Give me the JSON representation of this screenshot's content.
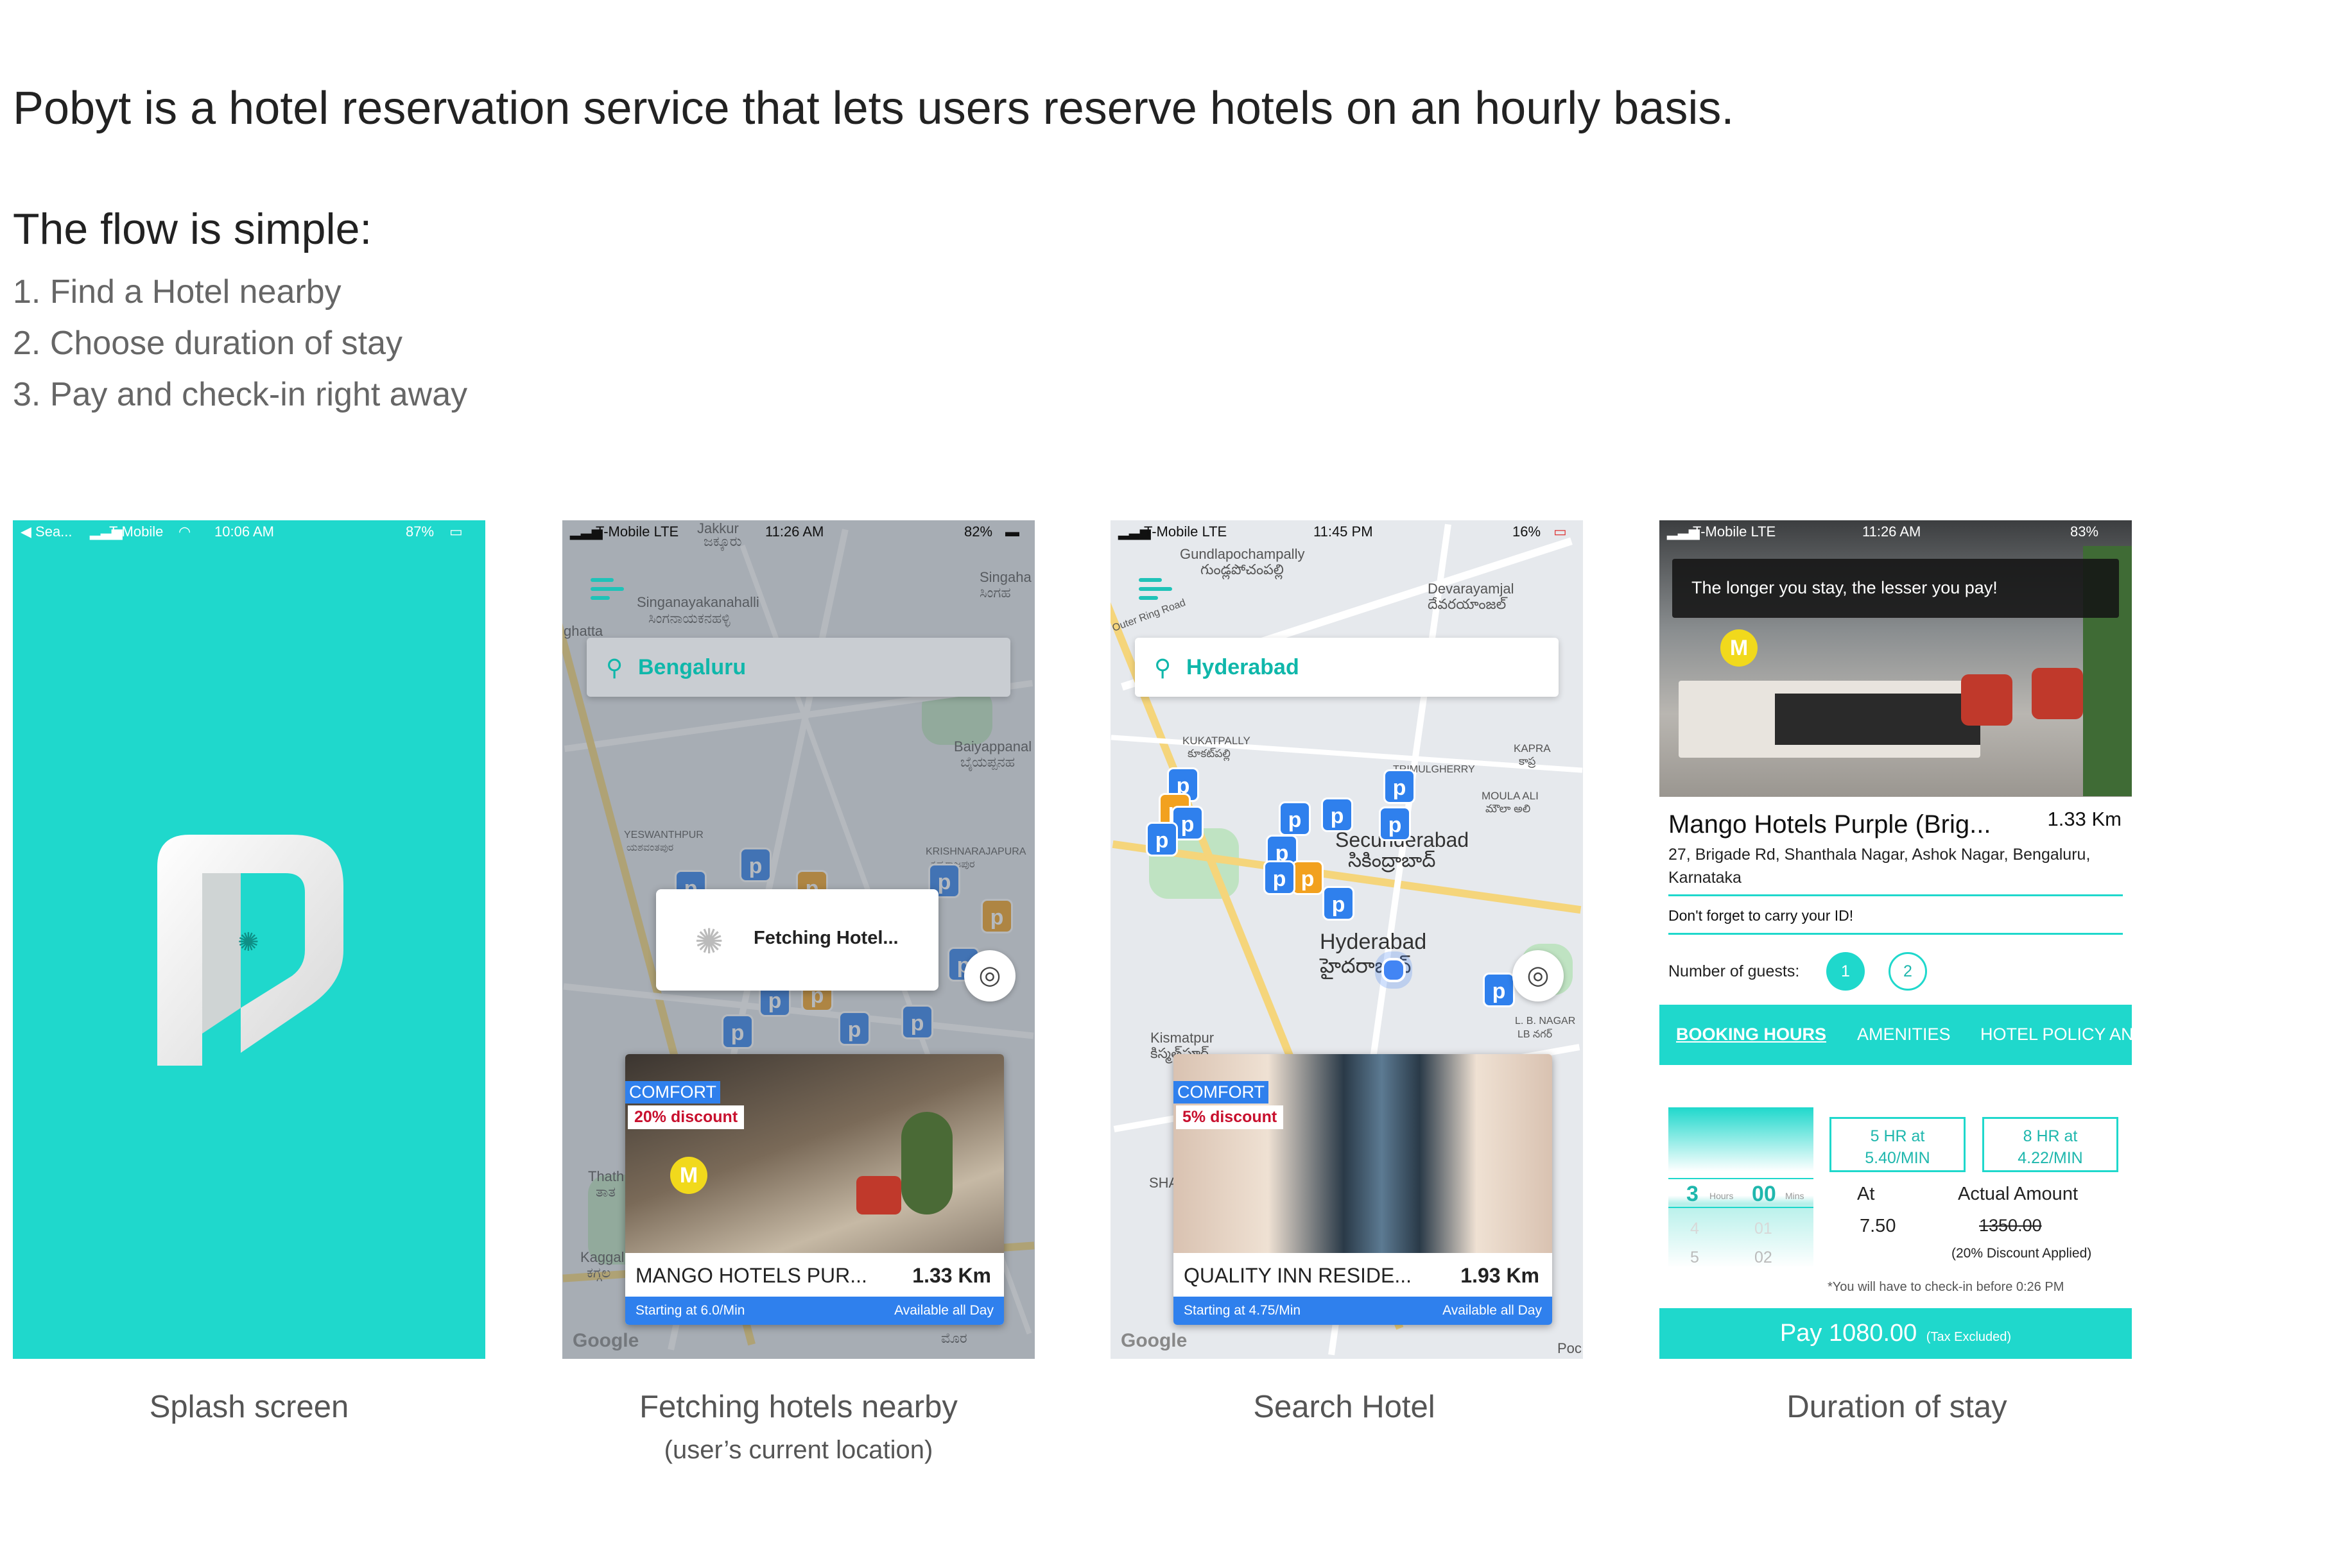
{
  "intro": "Pobyt is a hotel reservation service that lets users reserve hotels on an hourly basis.",
  "flow_title": "The flow is simple:",
  "steps": [
    "1. Find a Hotel nearby",
    "2. Choose duration of stay",
    "3. Pay and check-in right away"
  ],
  "colors": {
    "accent": "#1fd8cc",
    "pin_blue": "#2f80ed",
    "pin_orange": "#f2a11f",
    "discount_red": "#c8102e"
  },
  "screens": [
    {
      "caption": "Splash screen",
      "status": {
        "left": "◀ Sea...",
        "carrier": "T-Mobile",
        "time": "10:06 AM",
        "battery": "87%"
      },
      "logo": "pobyt-logo"
    },
    {
      "caption": "Fetching hotels nearby",
      "subcaption": "(user’s current location)",
      "status": {
        "carrier": "T-Mobile LTE",
        "time": "11:26 AM",
        "battery": "82%"
      },
      "search_value": "Bengaluru",
      "loading_text": "Fetching Hotel...",
      "map_labels": [
        "Singanayakanahalli",
        "ಸಿಂಗನಾಯಕನಹಳ್ಳಿ",
        "Singaha",
        "ಸಿಂಗಹ",
        "ghatta",
        "Baiyappanal",
        "ಬೈಯಪ್ಪನಹ",
        "YESWANTHPUR",
        "ಯಶವಂತಪುರ",
        "KRISHNARAJAPURA",
        "ಕೃಷ್ಣರಾಜಪುರ",
        "Thath",
        "ತಾತ",
        "Kaggal",
        "ಕಗ್ಗಲ",
        "Jakkur",
        "ಜಕ್ಕೂರು",
        "Google",
        "ಮೊರ"
      ],
      "card": {
        "tag": "COMFORT",
        "discount": "20% discount",
        "name": "MANGO HOTELS PUR...",
        "distance": "1.33 Km",
        "starting": "Starting at 6.0/Min",
        "availability": "Available all Day"
      }
    },
    {
      "caption": "Search Hotel",
      "status": {
        "carrier": "T-Mobile LTE",
        "time": "11:45 PM",
        "battery": "16%"
      },
      "search_value": "Hyderabad",
      "map_labels": [
        "Gundlapochampally",
        "గుండ్లపోచంపల్లి",
        "Outer Ring Road",
        "Devarayamjal",
        "దేవరయాంజల్",
        "KUKATPALLY",
        "కూకట్‌పల్లి",
        "TRIMULGHERRY",
        "KAPRA",
        "కాప్ర",
        "MOULA ALI",
        "మౌలా అలి",
        "Secunderabad",
        "సికింద్రాబాద్",
        "Hyderabad",
        "హైదరాబాద్",
        "L. B. NAGAR",
        "LB నగర్",
        "Kismatpur",
        "కిస్మత్‌పూర్",
        "SHA",
        "Google",
        "Poc"
      ],
      "card": {
        "tag": "COMFORT",
        "discount": "5% discount",
        "name": "QUALITY INN RESIDE...",
        "distance": "1.93 Km",
        "starting": "Starting at 4.75/Min",
        "availability": "Available all Day"
      }
    },
    {
      "caption": "Duration of stay",
      "status": {
        "carrier": "T-Mobile LTE",
        "time": "11:26 AM",
        "battery": "83%"
      },
      "toast": "The longer you stay, the lesser you pay!",
      "hotel_name": "Mango Hotels Purple (Brig...",
      "distance": "1.33 Km",
      "address": "27, Brigade Rd, Shanthala Nagar, Ashok Nagar, Bengaluru, Karnataka",
      "reminder": "Don't forget to carry your ID!",
      "guests_label": "Number of guests:",
      "guests": [
        "1",
        "2"
      ],
      "selected_guest": "1",
      "tabs": [
        "BOOKING HOURS",
        "AMENITIES",
        "HOTEL POLICY AN"
      ],
      "picker": {
        "hours": "3",
        "hours_unit": "Hours",
        "mins": "00",
        "mins_unit": "Mins",
        "below_hours": [
          "4",
          "5"
        ],
        "below_mins": [
          "01",
          "02"
        ]
      },
      "plans": [
        {
          "line1": "5 HR at",
          "line2": "5.40/MIN"
        },
        {
          "line1": "8 HR at",
          "line2": "4.22/MIN"
        }
      ],
      "at_label": "At",
      "at_value": "7.50",
      "actual_label": "Actual Amount",
      "actual_value": "1350.00",
      "discount_note": "(20% Discount Applied)",
      "checkin_note": "*You will have to check-in before 0:26 PM",
      "pay_label": "Pay 1080.00",
      "tax_note": "(Tax Excluded)"
    }
  ]
}
